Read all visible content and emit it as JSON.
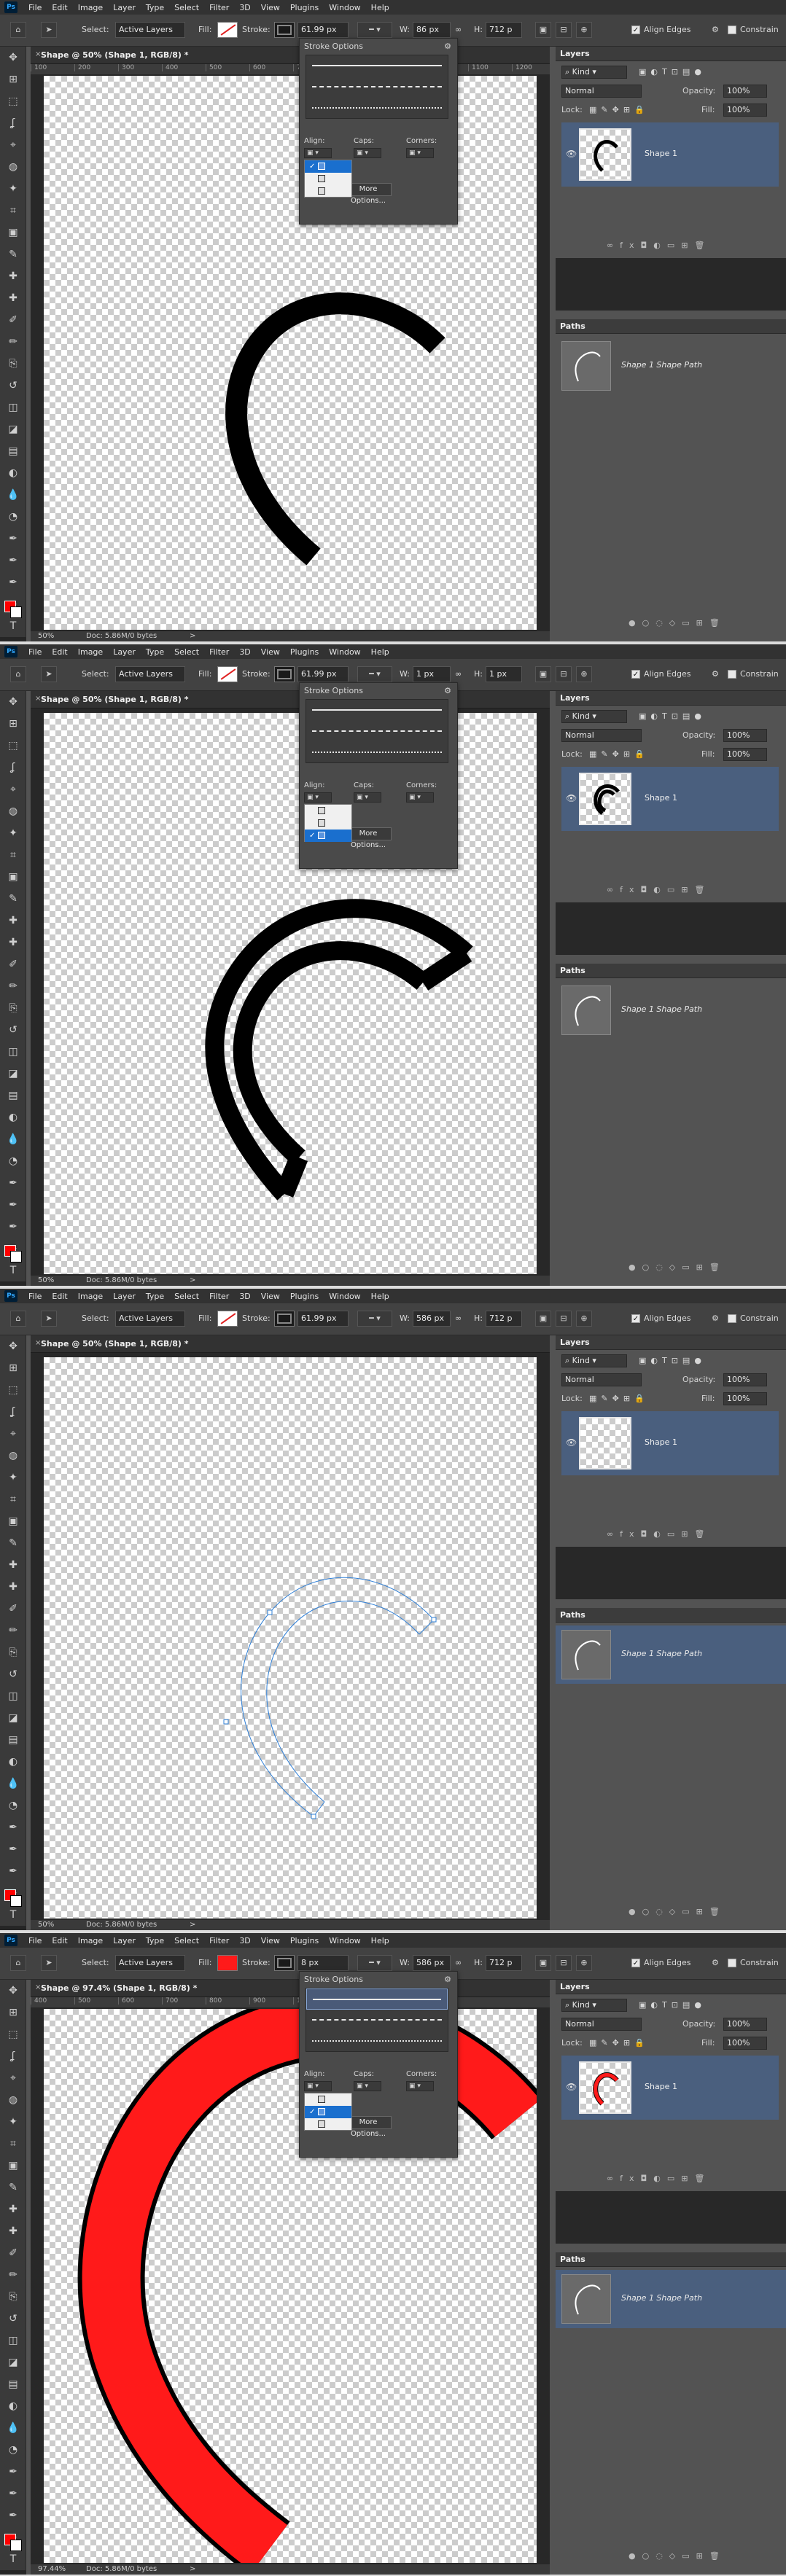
{
  "app": {
    "menu": [
      "File",
      "Edit",
      "Image",
      "Layer",
      "Type",
      "Select",
      "Filter",
      "3D",
      "View",
      "Plugins",
      "Window",
      "Help"
    ]
  },
  "colors": {
    "accent": "#1a6fce",
    "selected_row": "#4a5f7e",
    "fill_red": "#ff1a1a",
    "path_blue": "#2f7fd6"
  },
  "icons": [
    "home-icon",
    "path-select-icon",
    "gear-icon",
    "eye-icon",
    "close-icon",
    "link-icon"
  ],
  "popup": {
    "title": "Stroke Options",
    "align_label": "Align:",
    "caps_label": "Caps:",
    "corners_label": "Corners:",
    "more_options": "More Options...",
    "align_options": [
      "Inside",
      "Center",
      "Outside"
    ]
  },
  "layers_panel": {
    "tab": "Layers",
    "kind": "Kind",
    "blend_mode": "Normal",
    "opacity_label": "Opacity:",
    "opacity": "100%",
    "lock_label": "Lock:",
    "fill_label": "Fill:",
    "fill": "100%",
    "layer_name": "Shape 1"
  },
  "paths_panel": {
    "tab": "Paths",
    "path_name": "Shape 1 Shape Path"
  },
  "shots": [
    {
      "select_label": "Select:",
      "select_value": "Active Layers",
      "fill_label": "Fill:",
      "stroke_label": "Stroke:",
      "stroke_width": "61.99 px",
      "w_label": "W:",
      "w_value": "86 px",
      "h_label": "H:",
      "h_value": "712 p",
      "align_edges": "Align Edges",
      "constrain": "Constrain",
      "doc_title": "Shape @ 50% (Shape 1, RGB/8) *",
      "ruler": [
        "100",
        "200",
        "300",
        "400",
        "500",
        "600",
        "700",
        "800",
        "900",
        "1000",
        "1100",
        "1200"
      ],
      "zoom": "50%",
      "doc_info": "Doc: 5.86M/0 bytes",
      "status_arrow": ">",
      "align_checked": 0,
      "align_selected": 0
    },
    {
      "select_label": "Select:",
      "select_value": "Active Layers",
      "fill_label": "Fill:",
      "stroke_label": "Stroke:",
      "stroke_width": "61.99 px",
      "w_label": "W:",
      "w_value": "1 px",
      "h_label": "H:",
      "h_value": "1 px",
      "align_edges": "Align Edges",
      "constrain": "Constrain",
      "doc_title": "Shape @ 50% (Shape 1, RGB/8) *",
      "zoom": "50%",
      "doc_info": "Doc: 5.86M/0 bytes",
      "status_arrow": ">",
      "align_checked": 2,
      "align_selected": 2
    },
    {
      "select_label": "Select:",
      "select_value": "Active Layers",
      "fill_label": "Fill:",
      "stroke_label": "Stroke:",
      "stroke_width": "61.99 px",
      "w_label": "W:",
      "w_value": "586 px",
      "h_label": "H:",
      "h_value": "712 p",
      "align_edges": "Align Edges",
      "constrain": "Constrain",
      "doc_title": "Shape @ 50% (Shape 1, RGB/8) *",
      "zoom": "50%",
      "doc_info": "Doc: 5.86M/0 bytes",
      "status_arrow": ">"
    },
    {
      "select_label": "Select:",
      "select_value": "Active Layers",
      "fill_label": "Fill:",
      "stroke_label": "Stroke:",
      "stroke_width": "8 px",
      "w_label": "W:",
      "w_value": "586 px",
      "h_label": "H:",
      "h_value": "712 p",
      "align_edges": "Align Edges",
      "constrain": "Constrain",
      "doc_title": "Shape @ 97.4% (Shape 1, RGB/8) *",
      "ruler": [
        "400",
        "500",
        "600",
        "700",
        "800",
        "900",
        "1000",
        "1050"
      ],
      "zoom": "97.44%",
      "doc_info": "Doc: 5.86M/0 bytes",
      "status_arrow": ">",
      "align_checked": 1,
      "align_selected": 1
    }
  ]
}
